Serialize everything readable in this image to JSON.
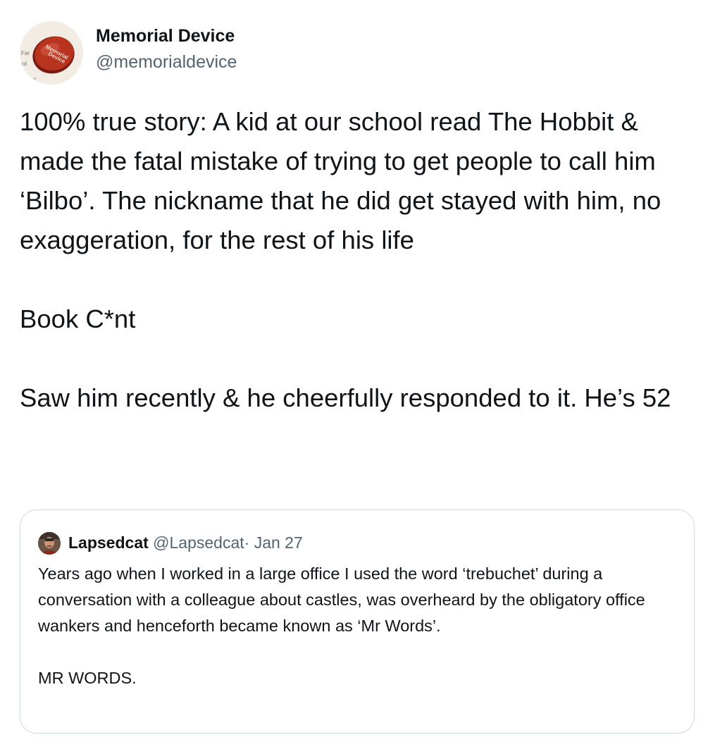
{
  "tweet": {
    "author": {
      "name": "Memorial Device",
      "handle": "@memorialdevice",
      "avatar_icon": "memorial-device-badge-icon"
    },
    "paragraphs": [
      "100% true story: A kid at our school read The Hobbit & made the fatal mistake of trying to get people to call him ‘Bilbo’. The nickname that he did get stayed with him, no exaggeration, for the rest of his life",
      "Book C*nt",
      "Saw him recently & he cheerfully responded to it. He’s 52"
    ]
  },
  "quoted_tweet": {
    "author": {
      "name": "Lapsedcat",
      "handle": "@Lapsedcat",
      "avatar_icon": "person-avatar-icon"
    },
    "date": "· Jan 27",
    "paragraphs": [
      "Years ago when I worked in a large office I used the word ‘trebuchet’ during a conversation with a colleague about castles, was overheard by the obligatory office wankers and henceforth became known as ‘Mr Words’.",
      "MR WORDS."
    ]
  },
  "colors": {
    "text_primary": "#0f1419",
    "text_secondary": "#536471",
    "border": "#cfd9de",
    "badge_red": "#b8341f"
  }
}
